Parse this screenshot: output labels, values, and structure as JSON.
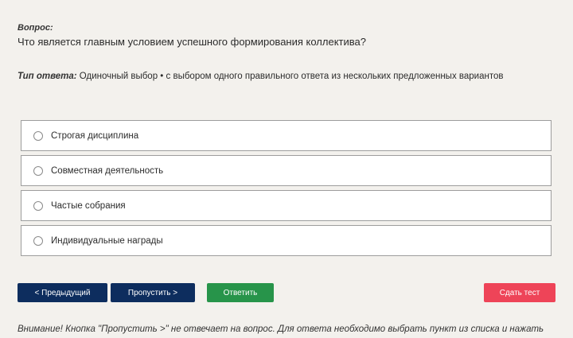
{
  "question": {
    "label": "Вопрос:",
    "text": "Что является главным условием успешного формирования коллектива?"
  },
  "answer_type": {
    "label": "Тип ответа:",
    "value": "Одиночный выбор • с выбором одного правильного ответа из нескольких предложенных вариантов"
  },
  "options": [
    {
      "label": "Строгая дисциплина",
      "selected": false
    },
    {
      "label": "Совместная деятельность",
      "selected": false
    },
    {
      "label": "Частые собрания",
      "selected": false
    },
    {
      "label": "Индивидуальные награды",
      "selected": false
    }
  ],
  "buttons": {
    "prev": "< Предыдущий",
    "skip": "Пропустить >",
    "answer": "Ответить",
    "finish": "Сдать тест"
  },
  "colors": {
    "navy": "#0d2d5e",
    "green": "#27944a",
    "red": "#ee4458",
    "background": "#f3f1ed"
  },
  "warning": "Внимание! Кнопка \"Пропустить >\" не отвечает на вопрос. Для ответа необходимо выбрать пункт из списка и нажать"
}
